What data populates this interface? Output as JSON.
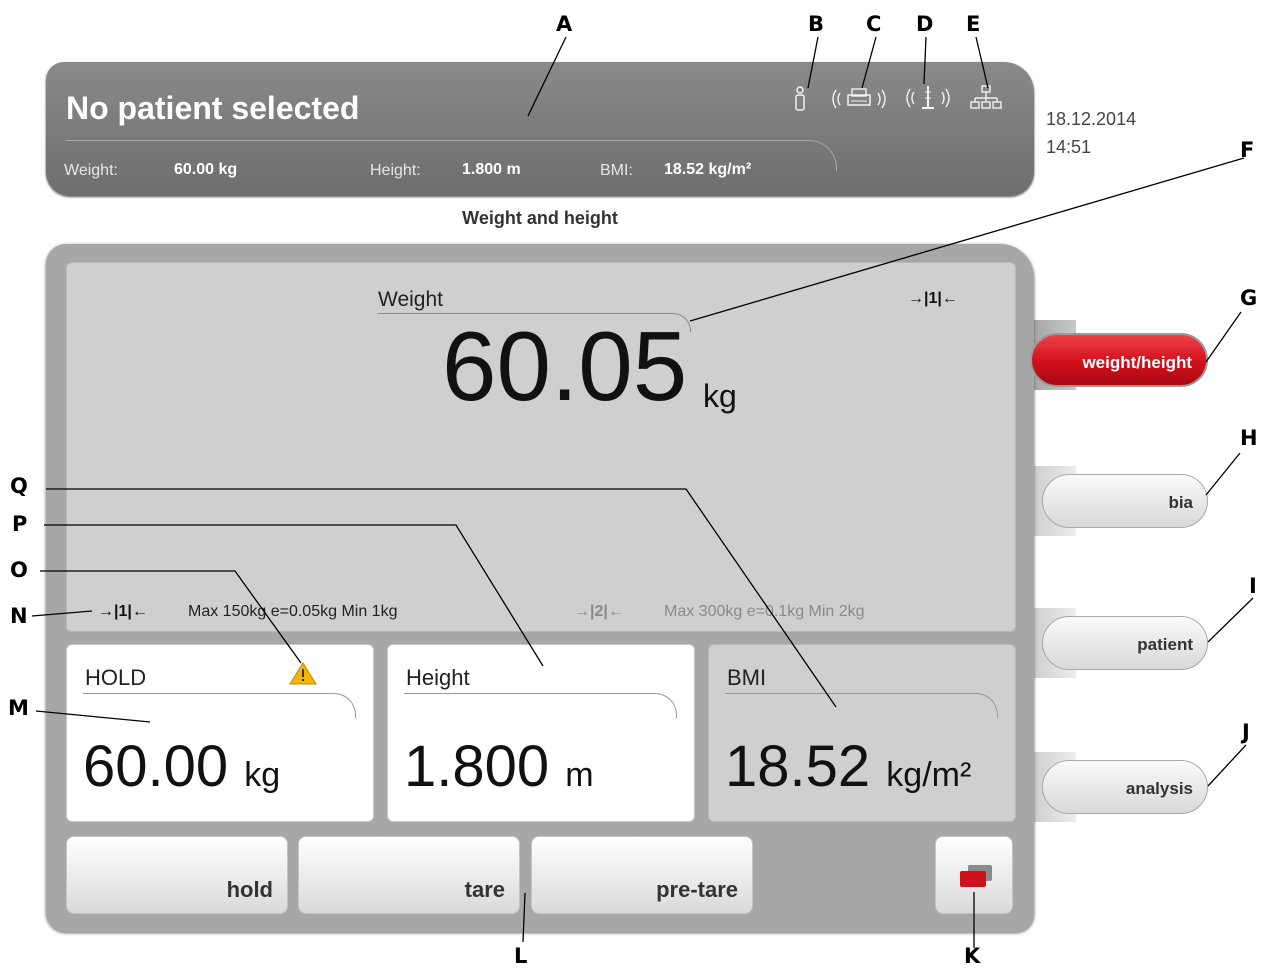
{
  "header": {
    "patient_title": "No patient selected",
    "weight_label": "Weight:",
    "weight_value": "60.00 kg",
    "height_label": "Height:",
    "height_value": "1.800 m",
    "bmi_label": "BMI:",
    "bmi_value": "18.52 kg/m²",
    "icons": [
      "person-icon",
      "printer-wireless-icon",
      "wireless-device-icon",
      "network-icon"
    ]
  },
  "datetime": {
    "date": "18.12.2014",
    "time": "14:51"
  },
  "screen_title": "Weight and height",
  "weight_panel": {
    "label": "Weight",
    "value": "60.05",
    "unit": "kg",
    "range_indicator": "→|1|←",
    "range1": {
      "indicator": "→|1|←",
      "text": "Max 150kg e=0.05kg Min 1kg"
    },
    "range2": {
      "indicator": "→|2|←",
      "text": "Max 300kg e=0.1kg Min 2kg"
    }
  },
  "cards": {
    "hold": {
      "label": "HOLD",
      "value": "60.00",
      "unit": "kg"
    },
    "height": {
      "label": "Height",
      "value": "1.800",
      "unit": "m"
    },
    "bmi": {
      "label": "BMI",
      "value": "18.52",
      "unit": "kg/m²"
    }
  },
  "buttons": {
    "hold": "hold",
    "tare": "tare",
    "pre_tare": "pre-tare"
  },
  "side_nav": {
    "weight_height": "weight/height",
    "bia": "bia",
    "patient": "patient",
    "analysis": "analysis",
    "active": "weight/height"
  },
  "colors": {
    "accent": "#d0101a",
    "header_bg": "#7c7c7c",
    "frame_bg": "#a7a7a7",
    "warning": "#f2b600"
  },
  "callouts": [
    "A",
    "B",
    "C",
    "D",
    "E",
    "F",
    "G",
    "H",
    "I",
    "J",
    "K",
    "L",
    "M",
    "N",
    "O",
    "P",
    "Q"
  ]
}
